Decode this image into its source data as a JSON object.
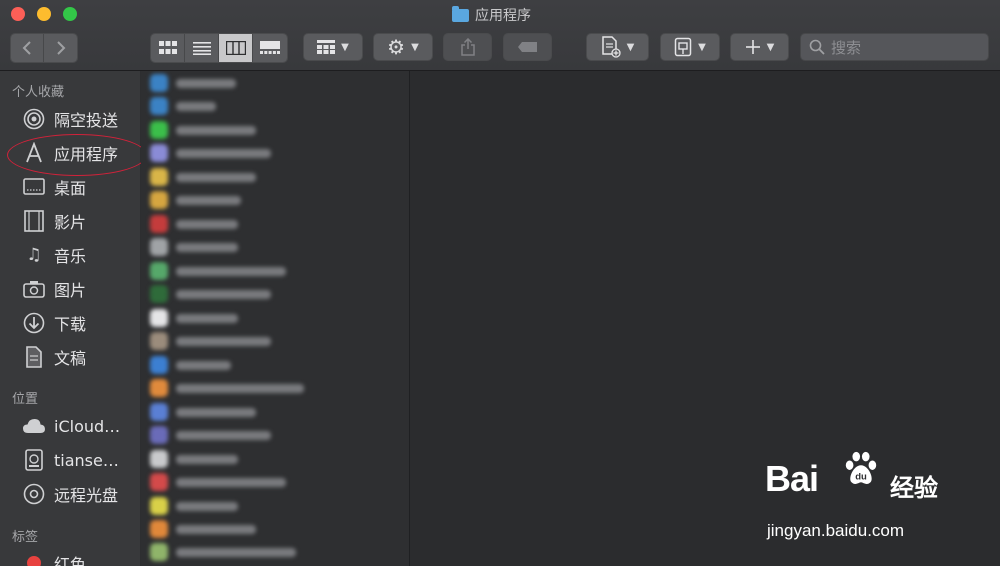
{
  "window": {
    "title": "应用程序"
  },
  "toolbar": {
    "search_placeholder": "搜索"
  },
  "sidebar": {
    "favorites_title": "个人收藏",
    "favorites": [
      {
        "label": "隔空投送",
        "icon": "airdrop-icon"
      },
      {
        "label": "应用程序",
        "icon": "applications-icon"
      },
      {
        "label": "桌面",
        "icon": "desktop-icon"
      },
      {
        "label": "影片",
        "icon": "movies-icon"
      },
      {
        "label": "音乐",
        "icon": "music-icon"
      },
      {
        "label": "图片",
        "icon": "pictures-icon"
      },
      {
        "label": "下载",
        "icon": "downloads-icon"
      },
      {
        "label": "文稿",
        "icon": "documents-icon"
      }
    ],
    "locations_title": "位置",
    "locations": [
      {
        "label": "iCloud…",
        "icon": "icloud-icon"
      },
      {
        "label": "tianse…",
        "icon": "disk-icon"
      },
      {
        "label": "远程光盘",
        "icon": "remote-disc-icon"
      }
    ],
    "tags_title": "标签",
    "tags": [
      {
        "label": "红色",
        "color": "#e8423f"
      }
    ]
  },
  "watermark": {
    "brand": "Bai",
    "suffix": "经验",
    "url": "jingyan.baidu.com"
  }
}
